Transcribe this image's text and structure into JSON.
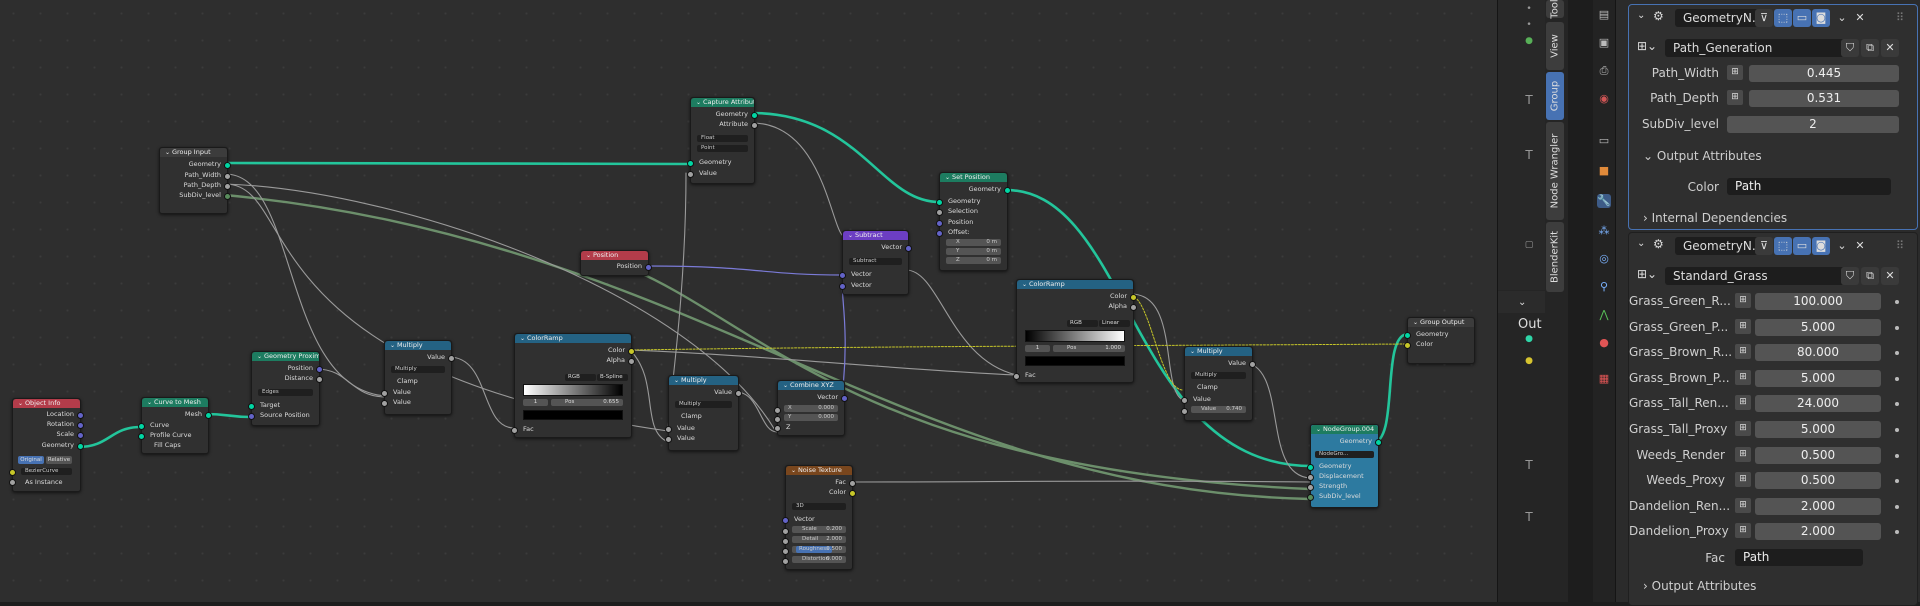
{
  "nodes": {
    "object_info": {
      "title": "Object Info",
      "outputs": [
        "Location",
        "Rotation",
        "Scale",
        "Geometry"
      ],
      "mode_a": "Original",
      "mode_b": "Relative",
      "object": "BezierCurve",
      "as_instance": "As Instance"
    },
    "curve_to_mesh": {
      "title": "Curve to Mesh",
      "output": "Mesh",
      "inputs": [
        "Curve",
        "Profile Curve"
      ],
      "fill_caps": "Fill Caps"
    },
    "geometry_proximity": {
      "title": "Geometry Proximity",
      "outputs": [
        "Position",
        "Distance"
      ],
      "mode": "Edges",
      "inputs": [
        "Target",
        "Source Position"
      ]
    },
    "multiply_1": {
      "title": "Multiply",
      "output": "Value",
      "op": "Multiply",
      "clamp": "Clamp",
      "inputs": [
        "Value",
        "Value"
      ]
    },
    "group_input": {
      "title": "Group Input",
      "outputs": [
        "Geometry",
        "Path_Width",
        "Path_Depth",
        "SubDiv_level"
      ]
    },
    "position": {
      "title": "Position",
      "output": "Position"
    },
    "color_ramp_1": {
      "title": "ColorRamp",
      "outputs": [
        "Color",
        "Alpha"
      ],
      "color_mode": "RGB",
      "interp": "B-Spline",
      "index": "1",
      "pos_label": "Pos",
      "pos": "0.655",
      "fac": "Fac"
    },
    "capture_attribute": {
      "title": "Capture Attribute",
      "outputs": [
        "Geometry",
        "Attribute"
      ],
      "type": "Float",
      "domain": "Point",
      "inputs": [
        "Geometry",
        "Value"
      ]
    },
    "multiply_2": {
      "title": "Multiply",
      "output": "Value",
      "op": "Multiply",
      "clamp": "Clamp",
      "inputs": [
        "Value",
        "Value"
      ]
    },
    "combine_xyz": {
      "title": "Combine XYZ",
      "output": "Vector",
      "x_label": "X",
      "x": "0.000",
      "y_label": "Y",
      "y": "0.000",
      "z": "Z"
    },
    "subtract": {
      "title": "Subtract",
      "output": "Vector",
      "op": "Subtract",
      "inputs": [
        "Vector",
        "Vector"
      ]
    },
    "set_position": {
      "title": "Set Position",
      "output": "Geometry",
      "inputs": [
        "Geometry",
        "Selection",
        "Position",
        "Offset:"
      ],
      "x_label": "X",
      "x": "0 m",
      "y_label": "Y",
      "y": "0 m",
      "z_label": "Z",
      "z": "0 m"
    },
    "color_ramp_2": {
      "title": "ColorRamp",
      "outputs": [
        "Color",
        "Alpha"
      ],
      "color_mode": "RGB",
      "interp": "Linear",
      "index": "1",
      "pos_label": "Pos",
      "pos": "1.000",
      "fac": "Fac"
    },
    "noise_texture": {
      "title": "Noise Texture",
      "outputs": [
        "Fac",
        "Color"
      ],
      "dims": "3D",
      "inputs": [
        "Vector"
      ],
      "scale_label": "Scale",
      "scale": "0.200",
      "detail_label": "Detail",
      "detail": "2.000",
      "rough_label": "Roughness",
      "rough": "0.500",
      "distortion_label": "Distortion",
      "distortion": "0.000"
    },
    "multiply_3": {
      "title": "Multiply",
      "output": "Value",
      "op": "Multiply",
      "clamp": "Clamp",
      "value_label": "Value",
      "value": "0.740",
      "input": "Value"
    },
    "nodegroup": {
      "title": "NodeGroup.004",
      "output": "Geometry",
      "group": "NodeGro...",
      "inputs": [
        "Geometry",
        "Displacement",
        "Strength",
        "SubDiv_level"
      ]
    },
    "group_output": {
      "title": "Group Output",
      "inputs": [
        "Geometry",
        "Color"
      ]
    }
  },
  "tabs": [
    "Tool",
    "View",
    "Group",
    "Node Wrangler",
    "BlenderKit"
  ],
  "active_tab": "Group",
  "output_header": "Out",
  "panel1": {
    "modifier_name": "GeometryN...",
    "group_name": "Path_Generation",
    "params": [
      {
        "label": "Path_Width",
        "value": "0.445"
      },
      {
        "label": "Path_Depth",
        "value": "0.531"
      },
      {
        "label": "SubDiv_level",
        "value": "2"
      }
    ],
    "output_attributes": "Output Attributes",
    "color_label": "Color",
    "color_value": "Path",
    "internal_deps": "Internal Dependencies"
  },
  "panel2": {
    "modifier_name": "GeometryN...",
    "group_name": "Standard_Grass",
    "params": [
      {
        "label": "Grass_Green_R...",
        "value": "100.000"
      },
      {
        "label": "Grass_Green_P...",
        "value": "5.000"
      },
      {
        "label": "Grass_Brown_R...",
        "value": "80.000"
      },
      {
        "label": "Grass_Brown_P...",
        "value": "5.000"
      },
      {
        "label": "Grass_Tall_Ren...",
        "value": "24.000"
      },
      {
        "label": "Grass_Tall_Proxy",
        "value": "5.000"
      },
      {
        "label": "Weeds_Render",
        "value": "0.500"
      },
      {
        "label": "Weeds_Proxy",
        "value": "0.500"
      },
      {
        "label": "Dandelion_Ren...",
        "value": "2.000"
      },
      {
        "label": "Dandelion_Proxy",
        "value": "2.000"
      }
    ],
    "fac_label": "Fac",
    "fac_value": "Path",
    "output_attributes": "Output Attributes"
  },
  "colors": {
    "geometry_socket": "#00d6a3",
    "float_socket": "#a1a1a1",
    "vector_socket": "#6363c7",
    "color_socket": "#c7c729",
    "accent": "#4772b3"
  }
}
